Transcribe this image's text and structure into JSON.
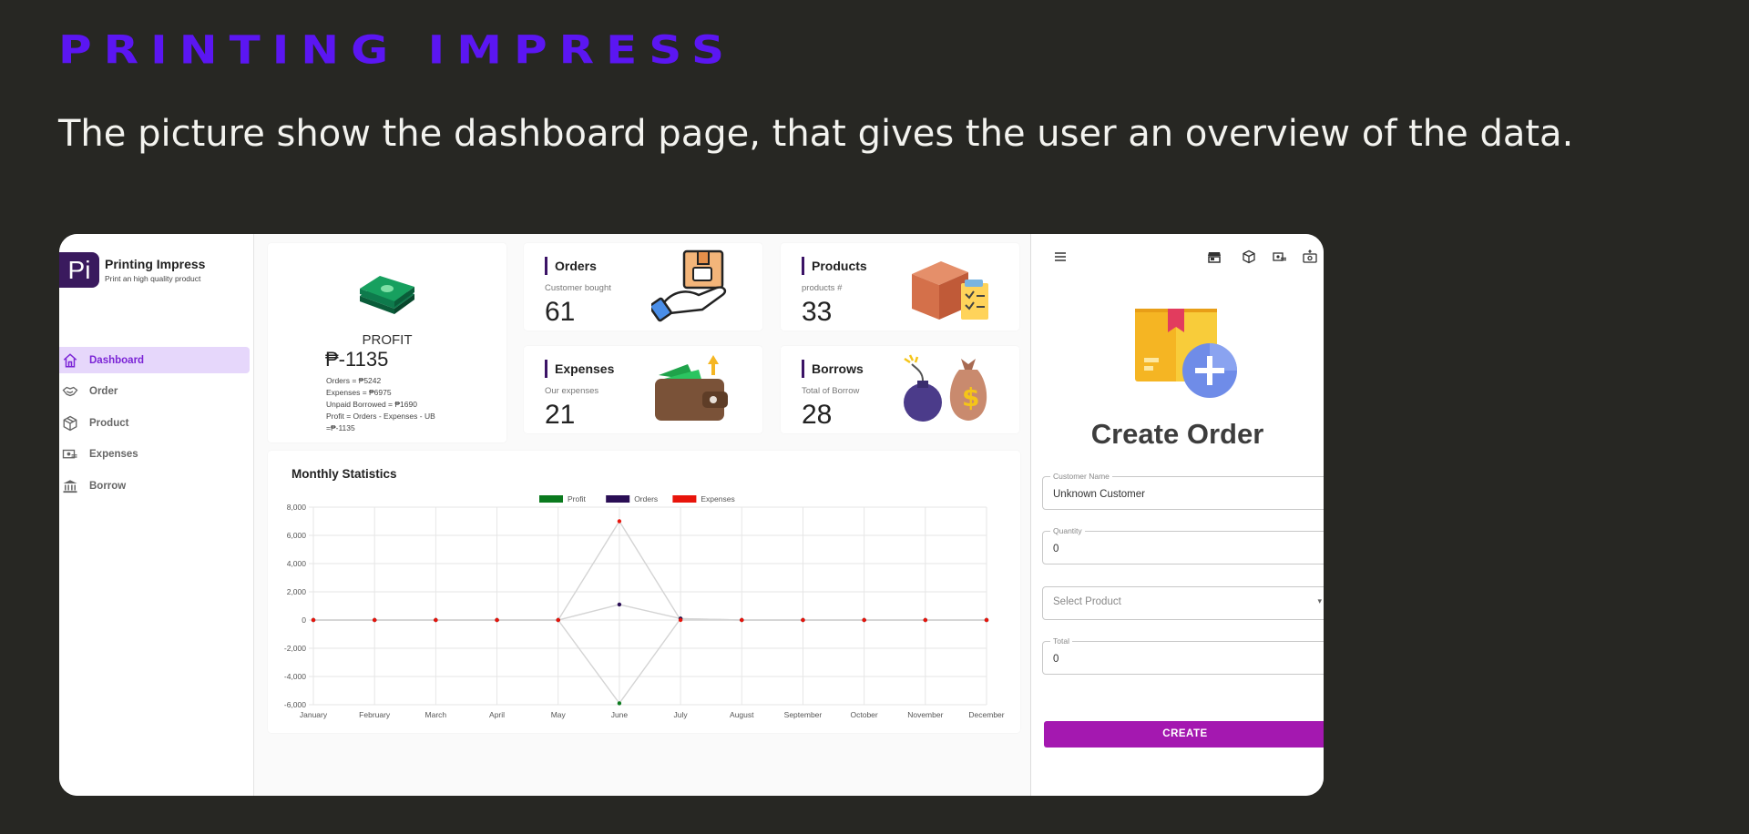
{
  "slide": {
    "title": "PRINTING IMPRESS",
    "description": "The picture show the dashboard page, that gives the user an overview of the data."
  },
  "app": {
    "logo_text": "Pi",
    "name": "Printing Impress",
    "tagline": "Print an high quality product"
  },
  "sidebar": {
    "items": [
      {
        "label": "Dashboard",
        "icon": "home-icon",
        "active": true
      },
      {
        "label": "Order",
        "icon": "handshake-icon",
        "active": false
      },
      {
        "label": "Product",
        "icon": "box-icon",
        "active": false
      },
      {
        "label": "Expenses",
        "icon": "money-icon",
        "active": false
      },
      {
        "label": "Borrow",
        "icon": "bank-icon",
        "active": false
      }
    ]
  },
  "profit_card": {
    "label": "PROFIT",
    "value": "₱-1135",
    "lines": [
      "Orders = ₱5242",
      "Expenses = ₱6975",
      "Unpaid Borrowed = ₱1690",
      "Profit = Orders - Expenses - UB",
      "=₱-1135"
    ]
  },
  "stats": {
    "orders": {
      "title": "Orders",
      "subtitle": "Customer bought",
      "value": "61"
    },
    "products": {
      "title": "Products",
      "subtitle": "products #",
      "value": "33"
    },
    "expenses": {
      "title": "Expenses",
      "subtitle": "Our expenses",
      "value": "21"
    },
    "borrows": {
      "title": "Borrows",
      "subtitle": "Total of Borrow",
      "value": "28"
    }
  },
  "chart": {
    "title": "Monthly Statistics"
  },
  "chart_data": {
    "type": "line",
    "title": "Monthly Statistics",
    "categories": [
      "January",
      "February",
      "March",
      "April",
      "May",
      "June",
      "July",
      "August",
      "September",
      "October",
      "November",
      "December"
    ],
    "series": [
      {
        "name": "Profit",
        "color": "#0b7a1e",
        "values": [
          0,
          0,
          0,
          0,
          0,
          -5900,
          100,
          0,
          0,
          0,
          0,
          0
        ]
      },
      {
        "name": "Orders",
        "color": "#2a0e55",
        "values": [
          0,
          0,
          0,
          0,
          0,
          1100,
          100,
          0,
          0,
          0,
          0,
          0
        ]
      },
      {
        "name": "Expenses",
        "color": "#e8140b",
        "values": [
          0,
          0,
          0,
          0,
          0,
          7000,
          0,
          0,
          0,
          0,
          0,
          0
        ]
      }
    ],
    "ylim": [
      -6000,
      8000
    ],
    "yticks": [
      "8,000",
      "6,000",
      "4,000",
      "2,000",
      "0",
      "-2,000",
      "-4,000",
      "-6,000"
    ],
    "grid": true,
    "legend": "top"
  },
  "right_panel": {
    "toolbar_icons": [
      "menu-icon",
      "store-icon",
      "box-icon",
      "money-icon",
      "cash-icon"
    ],
    "title": "Create Order",
    "customer_label": "Customer Name",
    "customer_value": "Unknown Customer",
    "quantity_label": "Quantity",
    "quantity_value": "0",
    "product_placeholder": "Select Product",
    "total_label": "Total",
    "total_value": "0",
    "create_label": "CREATE"
  }
}
